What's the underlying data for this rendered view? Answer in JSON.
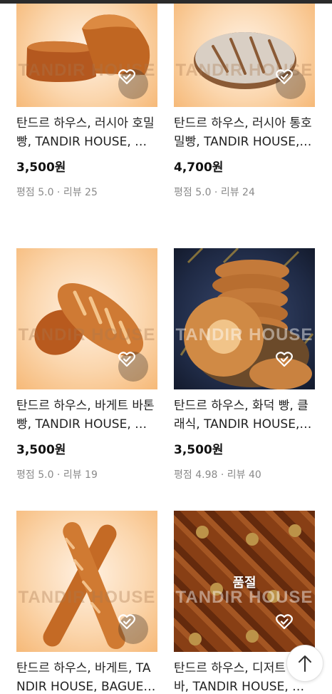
{
  "products": [
    {
      "title": "탄드르 하우스, 러시아 호밀빵, TANDIR HOUSE, 러시아 호밀빵",
      "price": "3,500원",
      "rating_label": "평점 5.0 · 리뷰 25",
      "watermark": "TANDIR HOUSE",
      "wishlist_icon": "heart-check-icon"
    },
    {
      "title": "탄드르 하우스, 러시아 통호밀빵, TANDIR HOUSE, 통호밀빵",
      "price": "4,700원",
      "rating_label": "평점 5.0 · 리뷰 24",
      "watermark": "TANDIR HOUSE",
      "wishlist_icon": "heart-check-icon"
    },
    {
      "title": "탄드르 하우스, 바게트 바톤빵, TANDIR HOUSE, 바톤빵",
      "price": "3,500원",
      "rating_label": "평점 5.0 · 리뷰 19",
      "watermark": "TANDIR HOUSE",
      "wishlist_icon": "heart-check-icon"
    },
    {
      "title": "탄드르 하우스, 화덕 빵, 클래식, TANDIR HOUSE, 화덕 빵",
      "price": "3,500원",
      "rating_label": "평점 4.98 · 리뷰 40",
      "watermark": "TANDIR HOUSE",
      "wishlist_icon": "heart-check-icon"
    },
    {
      "title": "탄드르 하우스, 바게트, TANDIR HOUSE, BAGUETTE",
      "price": "",
      "rating_label": "",
      "watermark": "TANDIR HOUSE",
      "wishlist_icon": "heart-check-icon"
    },
    {
      "title": "탄드르 하우스, 디저트 클라바, TANDIR HOUSE, 디저트",
      "price": "",
      "rating_label": "",
      "watermark": "TANDIR HOUSE",
      "soldout_label": "품절",
      "wishlist_icon": "heart-outline-icon"
    }
  ],
  "scroll_top_icon": "arrow-up-icon",
  "colors": {
    "card_bg_orange": "#fbd6ad",
    "meta_gray": "#8a8a8a",
    "price_black": "#111111"
  }
}
